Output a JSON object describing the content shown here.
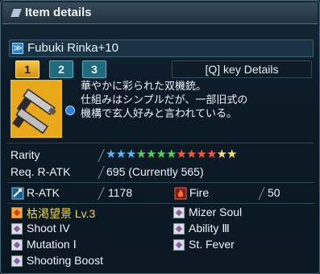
{
  "header": {
    "title": "Item details"
  },
  "item": {
    "name": "Fubuki Rinka+10"
  },
  "tabs": [
    {
      "label": "1",
      "active": true
    },
    {
      "label": "2",
      "active": false
    },
    {
      "label": "3",
      "active": false
    }
  ],
  "details_button": {
    "label": "[Q] key  Details"
  },
  "description": [
    "華やかに彩られた双機銃。",
    "仕組みはシンプルだが、一部旧式の",
    "機構で玄人好みと言われている。"
  ],
  "rarity": {
    "label": "Rarity",
    "stars": 13,
    "star_colors": [
      "#4fb6ff",
      "#4fb6ff",
      "#4fb6ff",
      "#4fd45a",
      "#4fd45a",
      "#4fd45a",
      "#4fd45a",
      "#ff5533",
      "#ff5533",
      "#ff5533",
      "#ff5533",
      "#ffe066",
      "#ffe066"
    ]
  },
  "req": {
    "label": "Req. R-ATK",
    "value": "695 (Currently 565)"
  },
  "atk": {
    "label": "R-ATK",
    "value": "1178",
    "icon": "ranged-attack-icon"
  },
  "element": {
    "label": "Fire",
    "value": "50",
    "icon": "fire-icon"
  },
  "affixes": [
    {
      "label": "枯渇望景 Lv.3",
      "special": true
    },
    {
      "label": "Mizer Soul",
      "special": false
    },
    {
      "label": "Shoot IV",
      "special": false
    },
    {
      "label": "Ability Ⅲ",
      "special": false
    },
    {
      "label": "Mutation Ⅰ",
      "special": false
    },
    {
      "label": "St. Fever",
      "special": false
    },
    {
      "label": "Shooting Boost",
      "special": false
    }
  ]
}
